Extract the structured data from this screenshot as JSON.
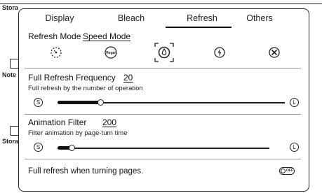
{
  "background": {
    "labels": [
      "Stora",
      "Note",
      "Stora"
    ]
  },
  "tabs": [
    {
      "label": "Display"
    },
    {
      "label": "Bleach"
    },
    {
      "label": "Refresh"
    },
    {
      "label": "Others"
    }
  ],
  "active_tab": "Refresh",
  "refresh_mode": {
    "label": "Refresh Mode",
    "value": "Speed Mode",
    "modes": [
      {
        "icon": "dotted-circle-icon"
      },
      {
        "icon": "regal-icon",
        "text": "Regal"
      },
      {
        "icon": "drop-circle-icon",
        "selected": true
      },
      {
        "icon": "bolt-circle-icon"
      },
      {
        "icon": "x-circle-icon"
      }
    ]
  },
  "full_refresh": {
    "label": "Full Refresh Frequency",
    "value": "20",
    "description": "Full refresh by the number of operation",
    "min_label": "S",
    "max_label": "L",
    "level": 0.22
  },
  "animation_filter": {
    "label": "Animation Filter",
    "value": "200",
    "description": "Filter animation by page-turn time",
    "min_label": "S",
    "max_label": "L",
    "level": 0.08
  },
  "turning_pages": {
    "label": "Full refresh when turning pages.",
    "toggle_text": "OFF",
    "enabled": false
  }
}
